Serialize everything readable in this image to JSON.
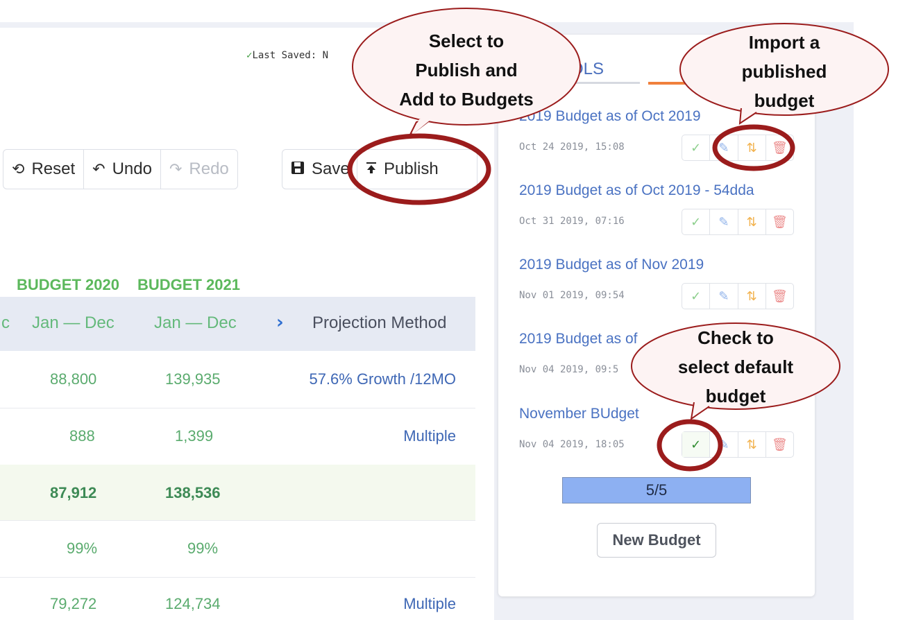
{
  "header": {
    "last_saved": "Last Saved: N"
  },
  "toolbar": {
    "reset_label": "Reset",
    "undo_label": "Undo",
    "redo_label": "Redo",
    "save_label": "Save",
    "publish_label": "Publish"
  },
  "table": {
    "group_headers": [
      "BUDGET 2020",
      "BUDGET 2021"
    ],
    "columns": [
      "c",
      "Jan — Dec",
      "Jan — Dec",
      "Projection Method"
    ],
    "rows": [
      {
        "budget_2020": "88,800",
        "budget_2021": "139,935",
        "method": "57.6% Growth /12MO"
      },
      {
        "budget_2020": "888",
        "budget_2021": "1,399",
        "method": "Multiple"
      },
      {
        "budget_2020": "87,912",
        "budget_2021": "138,536",
        "method": ""
      },
      {
        "budget_2020": "99%",
        "budget_2021": "99%",
        "method": ""
      },
      {
        "budget_2020": "79,272",
        "budget_2021": "124,734",
        "method": "Multiple"
      }
    ]
  },
  "side_panel": {
    "tab_label": "OLS",
    "budgets": [
      {
        "name": "2019 Budget as of Oct 2019",
        "date": "Oct 24 2019, 15:08"
      },
      {
        "name": "2019 Budget as of Oct 2019 - 54dda",
        "date": "Oct 31 2019, 07:16"
      },
      {
        "name": "2019 Budget as of Nov 2019",
        "date": "Nov 01 2019, 09:54"
      },
      {
        "name": "2019 Budget as of",
        "date": "Nov 04 2019, 09:5"
      },
      {
        "name": "November BUdget",
        "date": "Nov 04 2019, 18:05"
      }
    ],
    "pager": "5/5",
    "new_budget_label": "New Budget"
  },
  "callouts": {
    "publish": [
      "Select to",
      "Publish and",
      "Add to Budgets"
    ],
    "import": [
      "Import a",
      "published",
      "budget"
    ],
    "default": [
      "Check to",
      "select default",
      "budget"
    ]
  },
  "colors": {
    "accent_green": "#5cb85c",
    "link_blue": "#4a72c2",
    "tab_orange": "#f0803c",
    "callout_red": "#9b1c1c",
    "callout_fill": "#fdf3f3"
  }
}
